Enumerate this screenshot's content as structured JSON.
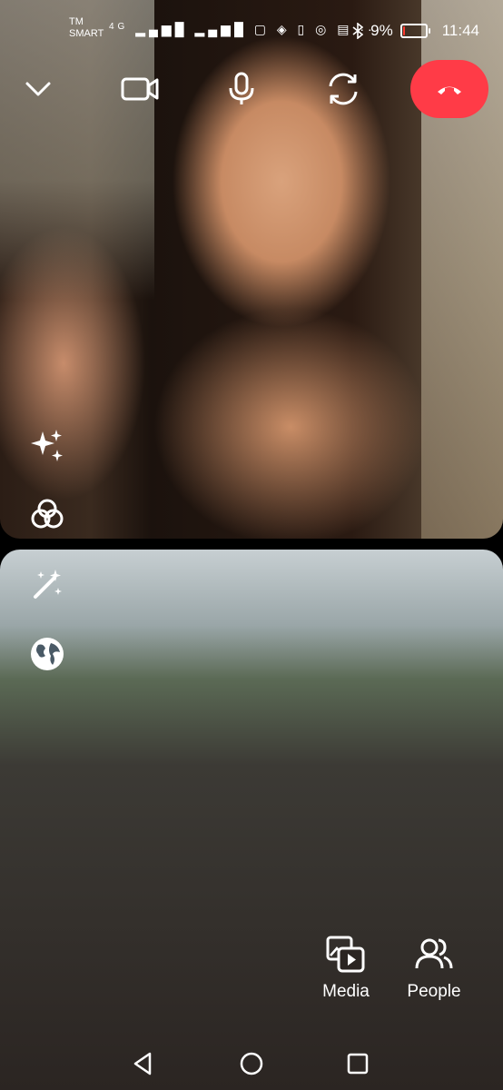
{
  "status_bar": {
    "carrier_line1": "TM",
    "carrier_line2": "SMART",
    "network": "4G",
    "battery_text": "9%",
    "battery_level": 0.09,
    "time": "11:44",
    "overflow": "···"
  },
  "controls": {
    "minimize_icon": "chevron-down-icon",
    "video_icon": "video-camera-icon",
    "mic_icon": "microphone-icon",
    "flip_icon": "flip-camera-icon",
    "end_call_icon": "end-call-icon",
    "end_call_color": "#ff3b47"
  },
  "side_effects": {
    "top_panel": [
      "sparkles-icon",
      "filters-icon"
    ],
    "bottom_panel": [
      "magic-wand-icon",
      "globe-icon"
    ]
  },
  "actions": {
    "media_label": "Media",
    "people_label": "People"
  },
  "nav": [
    "back-icon",
    "home-icon",
    "recents-icon"
  ]
}
